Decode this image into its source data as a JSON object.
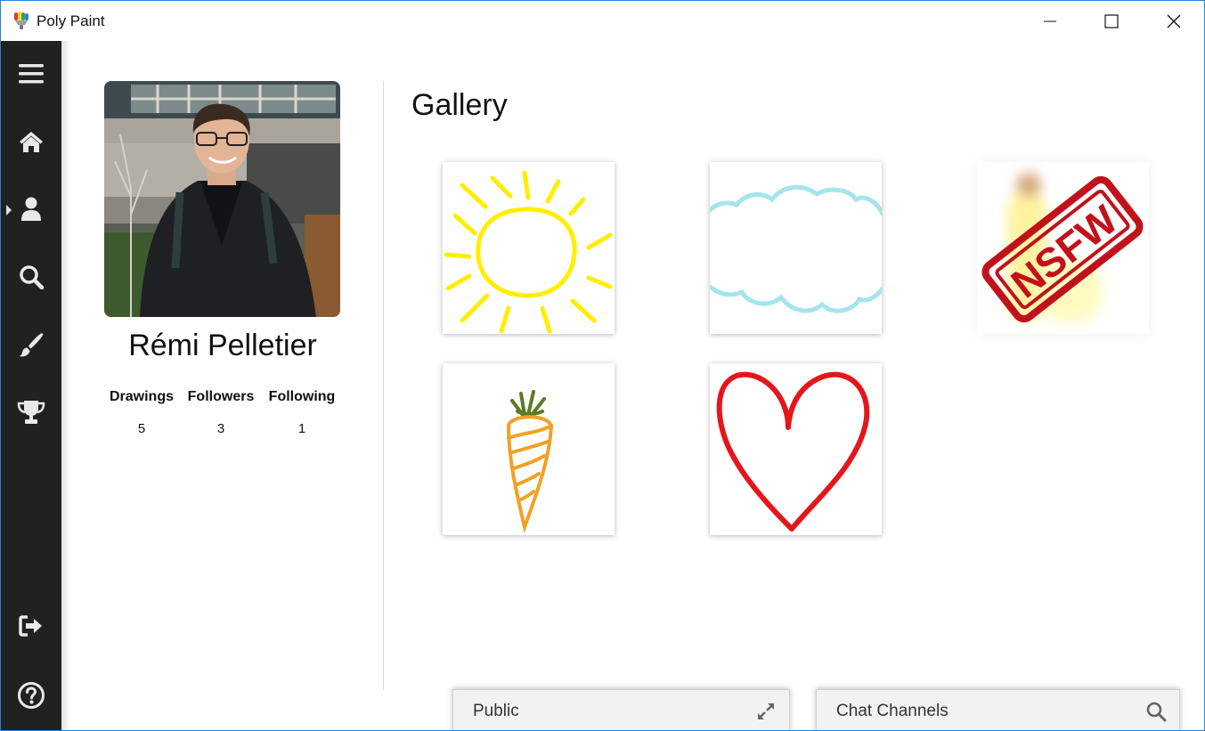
{
  "window": {
    "title": "Poly Paint"
  },
  "sidebar": {
    "items": [
      {
        "name": "menu-icon"
      },
      {
        "name": "home-icon"
      },
      {
        "name": "profile-icon",
        "active": true
      },
      {
        "name": "search-icon"
      },
      {
        "name": "brush-icon"
      },
      {
        "name": "trophy-icon"
      },
      {
        "name": "logout-icon"
      },
      {
        "name": "help-icon"
      }
    ],
    "background": "#212121"
  },
  "profile": {
    "name": "Rémi Pelletier",
    "stats": [
      {
        "label": "Drawings",
        "value": "5"
      },
      {
        "label": "Followers",
        "value": "3"
      },
      {
        "label": "Following",
        "value": "1"
      }
    ]
  },
  "gallery": {
    "title": "Gallery",
    "drawings": [
      {
        "subject": "sun",
        "color": "#ffee00"
      },
      {
        "subject": "cloud",
        "color": "#a6e4ec"
      },
      {
        "subject": "nsfw-blurred",
        "stamp_text": "NSFW",
        "stamp_color": "#c1121b"
      },
      {
        "subject": "carrot",
        "color": "#f2a024"
      },
      {
        "subject": "heart",
        "color": "#e3161b"
      }
    ]
  },
  "chat": {
    "public_label": "Public",
    "channels_label": "Chat Channels"
  }
}
